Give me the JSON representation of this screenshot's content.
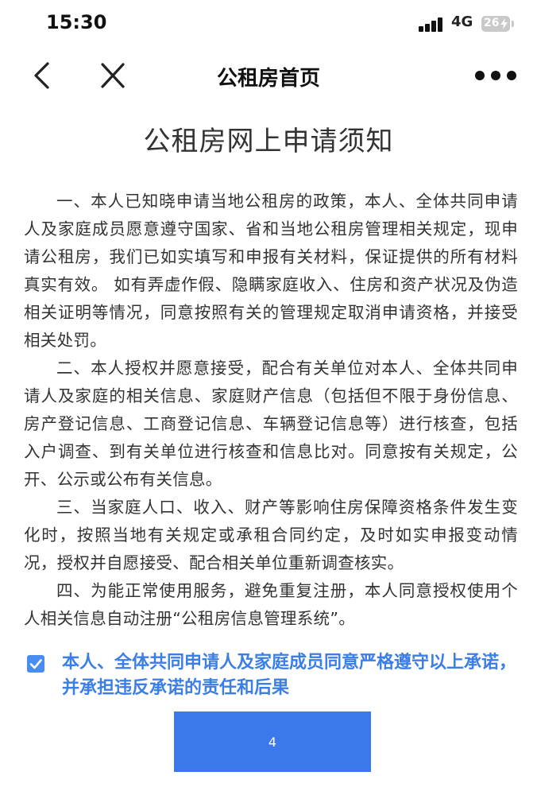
{
  "status_bar": {
    "time": "15:30",
    "network": "4G",
    "battery": "26",
    "icons": [
      "signal-icon",
      "battery-icon",
      "charging-icon"
    ]
  },
  "nav": {
    "title": "公租房首页",
    "icons": [
      "back-icon",
      "close-icon",
      "more-icon"
    ]
  },
  "document": {
    "title": "公租房网上申请须知",
    "paragraphs": [
      "一、本人已知晓申请当地公租房的政策，本人、全体共同申请人及家庭成员愿意遵守国家、省和当地公租房管理相关规定，现申请公租房，我们已如实填写和申报有关材料，保证提供的所有材料真实有效。 如有弄虚作假、隐瞒家庭收入、住房和资产状况及伪造相关证明等情况，同意按照有关的管理规定取消申请资格，并接受相关处罚。",
      "二、本人授权并愿意接受，配合有关单位对本人、全体共同申请人及家庭的相关信息、家庭财产信息（包括但不限于身份信息、房产登记信息、工商登记信息、车辆登记信息等）进行核查，包括入户调查、到有关单位进行核查和信息比对。同意按有关规定，公开、公示或公布有关信息。",
      "三、当家庭人口、收入、财产等影响住房保障资格条件发生变化时，按照当地有关规定或承租合同约定，及时如实申报变动情况，授权并自愿接受、配合相关单位重新调查核实。",
      "四、为能正常使用服务，避免重复注册，本人同意授权使用个人相关信息自动注册“公租房信息管理系统”。"
    ]
  },
  "agreement": {
    "checked": true,
    "text": "本人、全体共同申请人及家庭成员同意严格遵守以上承诺，并承担违反承诺的责任和后果"
  },
  "submit": {
    "label": "4"
  },
  "colors": {
    "accent": "#3b78ec",
    "agree_text": "#3a7ee6",
    "checkbox": "#4a8df0"
  }
}
